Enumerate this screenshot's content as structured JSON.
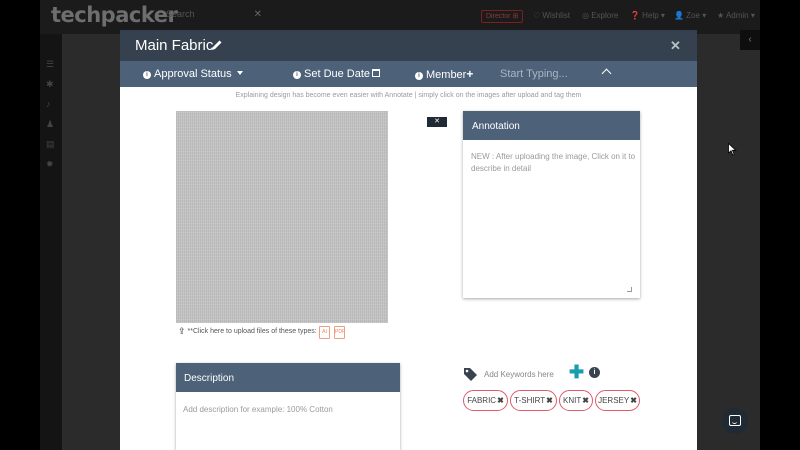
{
  "background_app": {
    "logo": "techpacker",
    "search_placeholder": "Search",
    "badge": "Director ⊞",
    "nav": {
      "wishlist": "♡ Wishlist",
      "explore": "◎ Explore",
      "help": "❓ Help ▾",
      "user": "👤 Zoe ▾",
      "admin": "★ Admin ▾"
    }
  },
  "modal": {
    "title": "Main Fabric",
    "close_label": "✕",
    "toolbar": {
      "approval_status": "Approval Status",
      "set_due_date": "Set Due Date",
      "member": "Member",
      "member_plus": "+",
      "member_search_placeholder": "Start Typing..."
    },
    "hint": "Explaining design has become even easier with Annotate | simply click on the images after upload and tag them",
    "upload": {
      "label": "**Click here to upload files of these types:",
      "types": [
        "AI",
        "PDF"
      ]
    },
    "remove_image_label": "✕",
    "annotation": {
      "title": "Annotation",
      "placeholder": "NEW : After uploading the image, Click on it to describe in detail"
    },
    "description": {
      "title": "Description",
      "placeholder": "Add description for example: 100% Cotton"
    },
    "keywords": {
      "placeholder": "Add Keywords here",
      "tags": [
        "FABRIC",
        "T-SHIRT",
        "KNIT",
        "JERSEY"
      ],
      "tag_remove": "✖"
    }
  },
  "colors": {
    "header": "#35414f",
    "toolbar": "#4d6178",
    "tag_border": "#e05a6a",
    "add_icon": "#1a9cb0"
  }
}
